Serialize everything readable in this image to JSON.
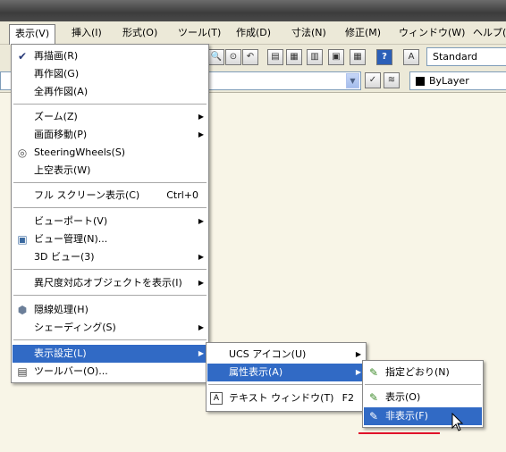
{
  "menubar": {
    "items": [
      "表示(V)",
      "挿入(I)",
      "形式(O)",
      "ツール(T)",
      "作成(D)",
      "寸法(N)",
      "修正(M)",
      "ウィンドウ(W)",
      "ヘルプ(H)"
    ]
  },
  "toolbar": {
    "style_combo": "Standard",
    "layer_combo": "ByLayer"
  },
  "view_menu": {
    "items": [
      {
        "label": "再描画(R)",
        "icon": "checkmark-icon"
      },
      {
        "label": "再作図(G)"
      },
      {
        "label": "全再作図(A)"
      },
      {
        "label": "ズーム(Z)",
        "submenu": true
      },
      {
        "label": "画面移動(P)",
        "submenu": true
      },
      {
        "label": "SteeringWheels(S)",
        "icon": "steering-wheel-icon"
      },
      {
        "label": "上空表示(W)"
      },
      {
        "label": "フル スクリーン表示(C)",
        "shortcut": "Ctrl+0"
      },
      {
        "label": "ビューポート(V)",
        "submenu": true
      },
      {
        "label": "ビュー管理(N)...",
        "icon": "view-manager-icon"
      },
      {
        "label": "3D ビュー(3)",
        "submenu": true
      },
      {
        "label": "異尺度対応オブジェクトを表示(I)",
        "submenu": true
      },
      {
        "label": "隠線処理(H)",
        "icon": "hide-icon"
      },
      {
        "label": "シェーディング(S)",
        "submenu": true
      },
      {
        "label": "表示設定(L)",
        "submenu": true
      },
      {
        "label": "ツールバー(O)...",
        "icon": "toolbar-icon"
      }
    ]
  },
  "display_submenu": {
    "items": [
      {
        "label": "UCS アイコン(U)",
        "submenu": true
      },
      {
        "label": "属性表示(A)",
        "submenu": true
      },
      {
        "label": "テキスト ウィンドウ(T)",
        "shortcut": "F2",
        "icon": "text-window-icon"
      }
    ]
  },
  "attribute_submenu": {
    "items": [
      {
        "label": "指定どおり(N)",
        "icon": "attribute-normal-icon"
      },
      {
        "label": "表示(O)",
        "icon": "attribute-on-icon"
      },
      {
        "label": "非表示(F)",
        "icon": "attribute-off-icon"
      }
    ]
  },
  "colors": {
    "highlight": "#316ac5",
    "annotation": "#e0102a"
  }
}
